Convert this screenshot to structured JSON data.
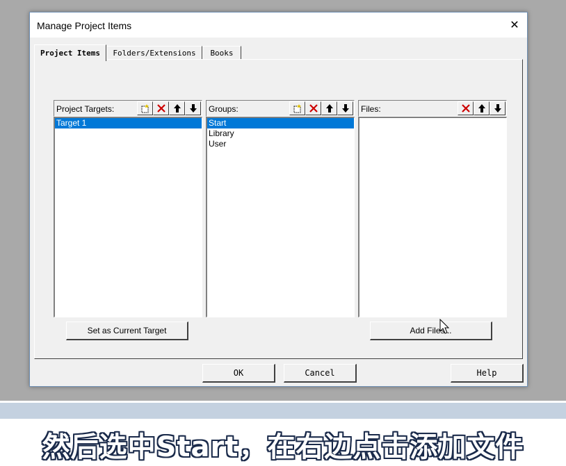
{
  "window": {
    "title": "Manage Project Items",
    "close_label": "✕"
  },
  "tabs": [
    {
      "label": "Project Items",
      "active": true
    },
    {
      "label": "Folders/Extensions",
      "active": false
    },
    {
      "label": "Books",
      "active": false
    }
  ],
  "targets_panel": {
    "label": "Project Targets:",
    "items": [
      {
        "label": "Target 1",
        "selected": true
      }
    ],
    "tools": [
      "new-icon",
      "delete-icon",
      "move-up-icon",
      "move-down-icon"
    ]
  },
  "groups_panel": {
    "label": "Groups:",
    "items": [
      {
        "label": "Start",
        "selected": true
      },
      {
        "label": "Library",
        "selected": false
      },
      {
        "label": "User",
        "selected": false
      }
    ],
    "tools": [
      "new-icon",
      "delete-icon",
      "move-up-icon",
      "move-down-icon"
    ]
  },
  "files_panel": {
    "label": "Files:",
    "items": [],
    "tools": [
      "delete-icon",
      "move-up-icon",
      "move-down-icon"
    ]
  },
  "buttons": {
    "set_current_target": "Set as Current Target",
    "add_files": "Add Files...",
    "ok": "OK",
    "cancel": "Cancel",
    "help": "Help"
  },
  "caption": "然后选中Start，在右边点击添加文件",
  "colors": {
    "selection": "#0078d7",
    "delete_red": "#cc0000"
  }
}
